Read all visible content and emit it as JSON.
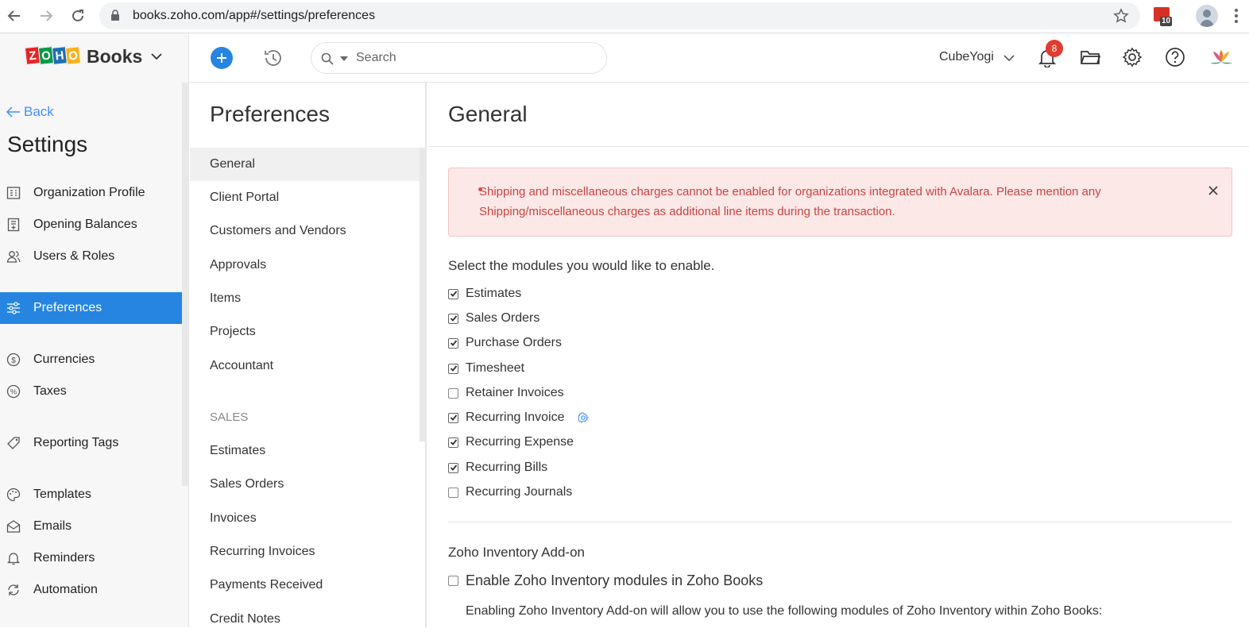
{
  "browser": {
    "url": "books.zoho.com/app#/settings/preferences",
    "extension_badge": "10"
  },
  "header": {
    "brand_logo_letters": [
      "Z",
      "O",
      "H",
      "O"
    ],
    "brand_name": "Books",
    "search_placeholder": "Search",
    "org_name": "CubeYogi",
    "notification_count": "8",
    "colors": {
      "accent": "#2685e0",
      "badge": "#e03c31"
    }
  },
  "sidebar": {
    "back_label": "Back",
    "title": "Settings",
    "items": [
      {
        "label": "Organization Profile",
        "icon": "organization-icon"
      },
      {
        "label": "Opening Balances",
        "icon": "ledger-icon"
      },
      {
        "label": "Users & Roles",
        "icon": "users-icon"
      },
      {
        "label": "Preferences",
        "icon": "sliders-icon",
        "active": true
      },
      {
        "label": "Currencies",
        "icon": "currency-icon"
      },
      {
        "label": "Taxes",
        "icon": "percent-icon"
      },
      {
        "label": "Reporting Tags",
        "icon": "tag-icon"
      },
      {
        "label": "Templates",
        "icon": "palette-icon"
      },
      {
        "label": "Emails",
        "icon": "email-icon"
      },
      {
        "label": "Reminders",
        "icon": "bell-icon"
      },
      {
        "label": "Automation",
        "icon": "automation-icon"
      }
    ]
  },
  "preferences": {
    "title": "Preferences",
    "items": [
      "General",
      "Client Portal",
      "Customers and Vendors",
      "Approvals",
      "Items",
      "Projects",
      "Accountant"
    ],
    "sales_section": "SALES",
    "sales_items": [
      "Estimates",
      "Sales Orders",
      "Invoices",
      "Recurring Invoices",
      "Payments Received",
      "Credit Notes"
    ]
  },
  "main": {
    "title": "General",
    "alert": "Shipping and miscellaneous charges cannot be enabled for organizations integrated with Avalara. Please mention any Shipping/miscellaneous charges as additional line items during the transaction.",
    "modules_label": "Select the modules you would like to enable.",
    "modules": [
      {
        "label": "Estimates",
        "checked": true
      },
      {
        "label": "Sales Orders",
        "checked": true
      },
      {
        "label": "Purchase Orders",
        "checked": true
      },
      {
        "label": "Timesheet",
        "checked": true
      },
      {
        "label": "Retainer Invoices",
        "checked": false
      },
      {
        "label": "Recurring Invoice",
        "checked": true
      },
      {
        "label": "Recurring Expense",
        "checked": true
      },
      {
        "label": "Recurring Bills",
        "checked": true
      },
      {
        "label": "Recurring Journals",
        "checked": false
      }
    ],
    "addon_title": "Zoho Inventory Add-on",
    "addon_checkbox": "Enable Zoho Inventory modules in Zoho Books",
    "addon_checked": false,
    "addon_desc": "Enabling Zoho Inventory Add-on will allow you to use the following modules of Zoho Inventory within Zoho Books:"
  }
}
